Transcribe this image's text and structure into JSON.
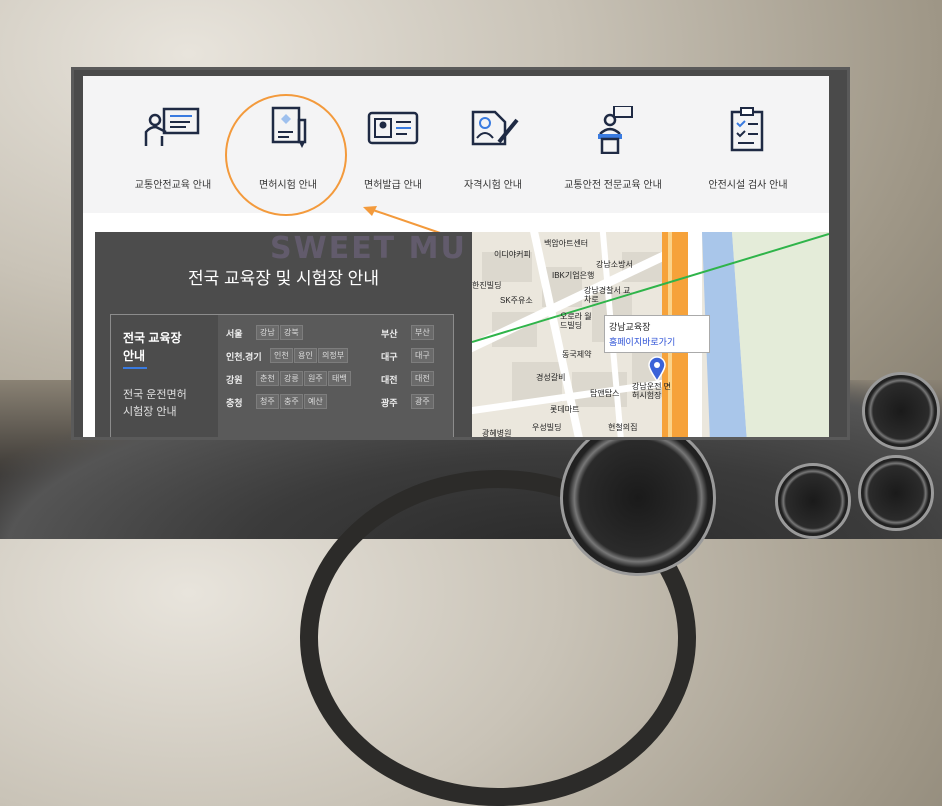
{
  "menu": {
    "items": [
      {
        "label": "교통안전교육 안내",
        "icon": "teacher-board-icon"
      },
      {
        "label": "면허시험 안내",
        "icon": "document-pen-icon"
      },
      {
        "label": "면허발급 안내",
        "icon": "id-card-icon"
      },
      {
        "label": "자격시험 안내",
        "icon": "person-pen-icon"
      },
      {
        "label": "교통안전 전문교육 안내",
        "icon": "lectern-speaker-icon"
      },
      {
        "label": "안전시설 검사 안내",
        "icon": "clipboard-checklist-icon"
      }
    ],
    "highlight_color": "#f39a3c"
  },
  "guide": {
    "title": "전국 교육장 및 시험장 안내",
    "tabs": [
      {
        "label": "전국 교육장\n안내",
        "active": true
      },
      {
        "label": "전국 운전면허\n시험장 안내",
        "active": false
      }
    ],
    "regions_left": [
      {
        "name": "서울",
        "chips": [
          "강남",
          "강북"
        ]
      },
      {
        "name": "인천.경기",
        "chips": [
          "인천",
          "용인",
          "의정부"
        ]
      },
      {
        "name": "강원",
        "chips": [
          "춘천",
          "강릉",
          "원주",
          "태백"
        ]
      },
      {
        "name": "충청",
        "chips": [
          "청주",
          "충주",
          "예산"
        ]
      }
    ],
    "regions_right": [
      {
        "name": "부산",
        "chips": [
          "부산"
        ]
      },
      {
        "name": "대구",
        "chips": [
          "대구"
        ]
      },
      {
        "name": "대전",
        "chips": [
          "대전"
        ]
      },
      {
        "name": "광주",
        "chips": [
          "광주"
        ]
      }
    ],
    "accent_color": "#3a7be0"
  },
  "map": {
    "popup_title": "강남교육장",
    "popup_link": "홈페이지바로가기",
    "labels": [
      "백암아트센터",
      "이디야커피",
      "강남소방서",
      "IBK기업은행",
      "한진빌딩",
      "SK주유소",
      "강남경찰서 교차로",
      "오로라 월드빌딩",
      "동국제약",
      "경성갈비",
      "탑앤탑스",
      "강남운전 면허시험장",
      "롯데마트",
      "우성빌딩",
      "현철의집",
      "광혜병원"
    ]
  },
  "watermark": "SWEET MU"
}
